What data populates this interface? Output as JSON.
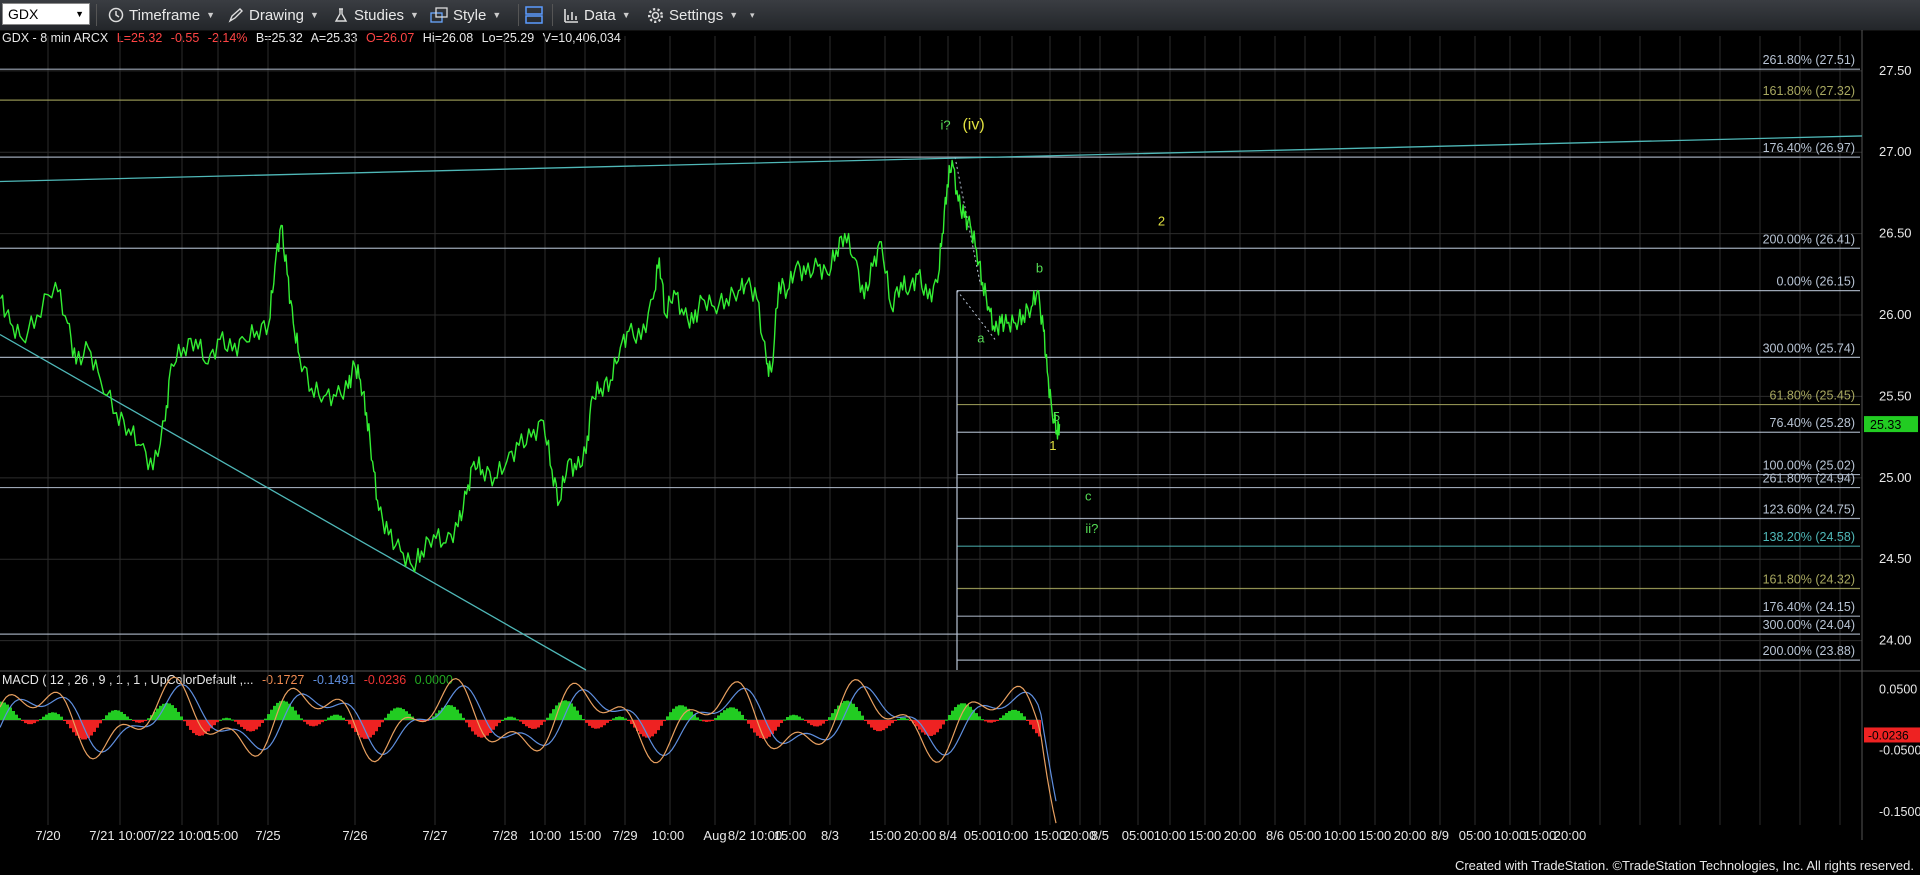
{
  "toolbar": {
    "symbol": "GDX",
    "timeframe": "Timeframe",
    "drawing": "Drawing",
    "studies": "Studies",
    "style": "Style",
    "data": "Data",
    "settings": "Settings"
  },
  "header": {
    "symbol_line": "GDX - 8 min  ARCX",
    "last": "L=25.32",
    "change": "-0.55",
    "pct": "-2.14%",
    "bid": "B=25.32",
    "ask": "A=25.33",
    "open": "O=26.07",
    "high": "Hi=26.08",
    "low": "Lo=25.29",
    "volume": "V=10,406,034"
  },
  "macd_header": {
    "label": "MACD ( 12 , 26 , 9 , 1 , 1 , UpColorDefault ,...",
    "macd": "-0.1727",
    "signal": "-0.1491",
    "diff": "-0.0236",
    "zero": "0.0000"
  },
  "footer": "Created with TradeStation. ©TradeStation Technologies, Inc. All rights reserved.",
  "colors": {
    "price": "#33ee33",
    "fib_gray": "#b8c4d4",
    "fib_olive": "#a8a860",
    "fib_teal": "#4fb8b8",
    "wave_yellow": "#e0e040",
    "wave_green": "#55dd55",
    "macd_line": "#e8a060",
    "signal_line": "#5f8fdf",
    "hist_up": "#22cc22",
    "hist_down": "#ee2222"
  },
  "chart_data": {
    "type": "line",
    "title": "GDX - 8 min ARCX",
    "ylim": [
      23.8,
      27.72
    ],
    "yticks": [
      "27.50",
      "27.00",
      "26.50",
      "26.00",
      "25.50",
      "25.00",
      "24.50",
      "24.00"
    ],
    "x_labels": [
      "7/20",
      "7/21 10:00",
      "7/22 10:00",
      "15:00",
      "7/25",
      "7/26",
      "7/27",
      "7/28",
      "10:00",
      "15:00",
      "7/29",
      "10:00",
      "Aug",
      "8/2 10:00",
      "15:00",
      "8/3",
      "15:00",
      "20:00",
      "8/4",
      "05:00",
      "10:00",
      "15:00",
      "20:00",
      "8/5",
      "05:00",
      "10:00",
      "15:00",
      "20:00",
      "8/6",
      "05:00",
      "10:00",
      "15:00",
      "20:00",
      "8/9",
      "05:00",
      "10:00",
      "15:00",
      "20:00"
    ],
    "last_price": "25.33",
    "price_path": [
      [
        0,
        26.1
      ],
      [
        8,
        25.95
      ],
      [
        18,
        25.85
      ],
      [
        30,
        26.0
      ],
      [
        45,
        26.2
      ],
      [
        55,
        25.95
      ],
      [
        62,
        25.7
      ],
      [
        72,
        25.8
      ],
      [
        82,
        25.6
      ],
      [
        95,
        25.4
      ],
      [
        105,
        25.3
      ],
      [
        115,
        25.2
      ],
      [
        125,
        25.05
      ],
      [
        135,
        25.35
      ],
      [
        140,
        25.7
      ],
      [
        150,
        25.8
      ],
      [
        160,
        25.85
      ],
      [
        170,
        25.7
      ],
      [
        180,
        25.85
      ],
      [
        190,
        25.78
      ],
      [
        200,
        25.85
      ],
      [
        210,
        25.9
      ],
      [
        220,
        25.95
      ],
      [
        225,
        26.3
      ],
      [
        230,
        26.55
      ],
      [
        235,
        26.25
      ],
      [
        240,
        25.95
      ],
      [
        245,
        25.75
      ],
      [
        255,
        25.55
      ],
      [
        265,
        25.5
      ],
      [
        275,
        25.5
      ],
      [
        285,
        25.55
      ],
      [
        290,
        25.7
      ],
      [
        295,
        25.6
      ],
      [
        300,
        25.4
      ],
      [
        305,
        25.1
      ],
      [
        310,
        24.8
      ],
      [
        318,
        24.65
      ],
      [
        328,
        24.55
      ],
      [
        338,
        24.45
      ],
      [
        345,
        24.55
      ],
      [
        355,
        24.65
      ],
      [
        365,
        24.6
      ],
      [
        375,
        24.7
      ],
      [
        382,
        24.9
      ],
      [
        388,
        25.1
      ],
      [
        395,
        25.05
      ],
      [
        405,
        25.0
      ],
      [
        415,
        25.1
      ],
      [
        425,
        25.2
      ],
      [
        435,
        25.25
      ],
      [
        445,
        25.35
      ],
      [
        452,
        25.05
      ],
      [
        458,
        24.85
      ],
      [
        465,
        25.1
      ],
      [
        472,
        25.05
      ],
      [
        480,
        25.15
      ],
      [
        485,
        25.5
      ],
      [
        492,
        25.55
      ],
      [
        500,
        25.6
      ],
      [
        508,
        25.8
      ],
      [
        515,
        25.9
      ],
      [
        525,
        25.85
      ],
      [
        535,
        26.1
      ],
      [
        540,
        26.35
      ],
      [
        545,
        26.0
      ],
      [
        552,
        26.15
      ],
      [
        560,
        26.0
      ],
      [
        568,
        25.95
      ],
      [
        575,
        26.1
      ],
      [
        585,
        26.05
      ],
      [
        595,
        26.1
      ],
      [
        605,
        26.15
      ],
      [
        612,
        26.2
      ],
      [
        620,
        26.1
      ],
      [
        628,
        25.7
      ],
      [
        632,
        25.65
      ],
      [
        638,
        26.2
      ],
      [
        645,
        26.15
      ],
      [
        652,
        26.3
      ],
      [
        660,
        26.25
      ],
      [
        670,
        26.3
      ],
      [
        678,
        26.25
      ],
      [
        685,
        26.4
      ],
      [
        692,
        26.5
      ],
      [
        700,
        26.35
      ],
      [
        708,
        26.1
      ],
      [
        715,
        26.3
      ],
      [
        722,
        26.45
      ],
      [
        730,
        26.05
      ],
      [
        738,
        26.2
      ],
      [
        745,
        26.15
      ],
      [
        752,
        26.25
      ],
      [
        760,
        26.1
      ],
      [
        768,
        26.2
      ],
      [
        772,
        26.5
      ],
      [
        776,
        26.8
      ],
      [
        780,
        26.95
      ],
      [
        785,
        26.7
      ],
      [
        790,
        26.6
      ],
      [
        795,
        26.55
      ],
      [
        800,
        26.4
      ],
      [
        805,
        26.2
      ],
      [
        810,
        26.05
      ],
      [
        815,
        25.9
      ],
      [
        820,
        25.95
      ],
      [
        825,
        25.95
      ],
      [
        832,
        25.95
      ],
      [
        838,
        26.0
      ],
      [
        845,
        26.05
      ],
      [
        850,
        26.15
      ],
      [
        855,
        25.9
      ],
      [
        858,
        25.65
      ],
      [
        862,
        25.4
      ],
      [
        866,
        25.29
      ],
      [
        868,
        25.33
      ]
    ],
    "fib_levels": [
      {
        "label": "261.80% (27.51)",
        "value": 27.51,
        "color": "fib_gray"
      },
      {
        "label": "161.80% (27.32)",
        "value": 27.32,
        "color": "fib_olive"
      },
      {
        "label": "176.40% (26.97)",
        "value": 26.97,
        "color": "fib_gray"
      },
      {
        "label": "200.00% (26.41)",
        "value": 26.41,
        "color": "fib_gray"
      },
      {
        "label": "0.00% (26.15)",
        "value": 26.15,
        "color": "fib_gray"
      },
      {
        "label": "300.00% (25.74)",
        "value": 25.74,
        "color": "fib_gray"
      },
      {
        "label": "61.80% (25.45)",
        "value": 25.45,
        "color": "fib_olive"
      },
      {
        "label": "76.40% (25.28)",
        "value": 25.28,
        "color": "fib_gray"
      },
      {
        "label": "100.00% (25.02)",
        "value": 25.02,
        "color": "fib_gray"
      },
      {
        "label": "261.80% (24.94)",
        "value": 24.94,
        "color": "fib_gray"
      },
      {
        "label": "123.60% (24.75)",
        "value": 24.75,
        "color": "fib_gray"
      },
      {
        "label": "138.20% (24.58)",
        "value": 24.58,
        "color": "fib_teal"
      },
      {
        "label": "161.80% (24.32)",
        "value": 24.32,
        "color": "fib_olive"
      },
      {
        "label": "176.40% (24.15)",
        "value": 24.15,
        "color": "fib_gray"
      },
      {
        "label": "300.00% (24.04)",
        "value": 24.04,
        "color": "fib_gray"
      },
      {
        "label": "200.00% (23.88)",
        "value": 23.88,
        "color": "fib_gray"
      }
    ],
    "wave_labels": [
      {
        "text": "i?",
        "x": 775,
        "y": 27.14,
        "color": "wave_green"
      },
      {
        "text": "(iv)",
        "x": 798,
        "y": 27.14,
        "color": "wave_yellow"
      },
      {
        "text": "2",
        "x": 952,
        "y": 26.55,
        "color": "wave_yellow"
      },
      {
        "text": "b",
        "x": 852,
        "y": 26.26,
        "color": "wave_green"
      },
      {
        "text": "a",
        "x": 804,
        "y": 25.83,
        "color": "wave_green"
      },
      {
        "text": "5",
        "x": 866,
        "y": 25.35,
        "color": "wave_green"
      },
      {
        "text": "1",
        "x": 863,
        "y": 25.17,
        "color": "wave_yellow"
      },
      {
        "text": "c",
        "x": 892,
        "y": 24.86,
        "color": "wave_green"
      },
      {
        "text": "ii?",
        "x": 895,
        "y": 24.66,
        "color": "wave_green"
      }
    ],
    "macd_ylim": [
      -0.19,
      0.09
    ],
    "macd_yticks": [
      "0.0500",
      "-0.0500",
      "-0.1500"
    ],
    "macd_value_label": "-0.0236"
  }
}
